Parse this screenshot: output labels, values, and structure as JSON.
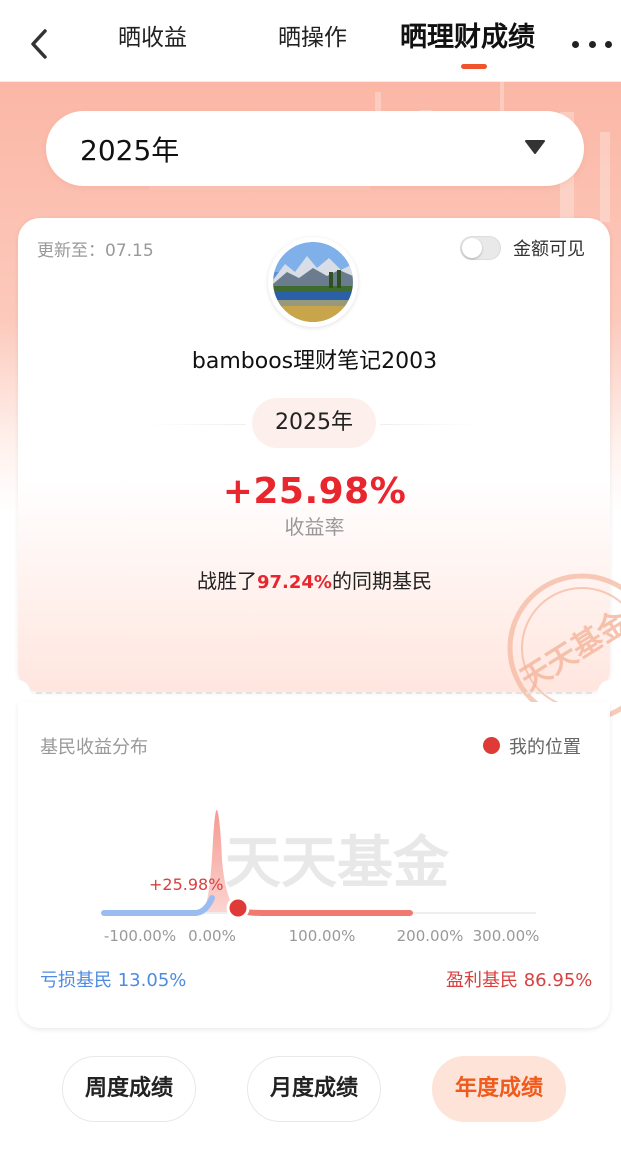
{
  "nav": {
    "tabs": [
      "晒收益",
      "晒操作",
      "晒理财成绩"
    ],
    "active_tab": "晒理财成绩",
    "icons": [
      "chevron-left-icon",
      "more-icon"
    ]
  },
  "year_select": {
    "value": "2025年"
  },
  "card": {
    "update_text": "更新至：07.15",
    "amount_visible_label": "金额可见",
    "amount_visible": false,
    "username": "bamboos理财笔记2003",
    "year": "2025年",
    "return_rate": "+25.98%",
    "return_label": "收益率",
    "beat_prefix": "战胜了",
    "beat_pct": "97.24%",
    "beat_suffix": "的同期基民",
    "watermark": "天天基金"
  },
  "distribution": {
    "title": "基民收益分布",
    "my_position_label": "我的位置",
    "my_position_value": "+25.98%",
    "watermark": "天天基金",
    "x_ticks": [
      "-100.00%",
      "0.00%",
      "100.00%",
      "200.00%",
      "300.00%"
    ],
    "loss_label": "亏损基民",
    "loss_pct": "13.05%",
    "profit_label": "盈利基民",
    "profit_pct": "86.95%",
    "colors": {
      "loss": "#9bbcf0",
      "profit": "#f07a72",
      "marker": "#e03a38"
    }
  },
  "bottom_tabs": [
    "周度成绩",
    "月度成绩",
    "年度成绩"
  ],
  "bottom_active": "年度成绩"
}
